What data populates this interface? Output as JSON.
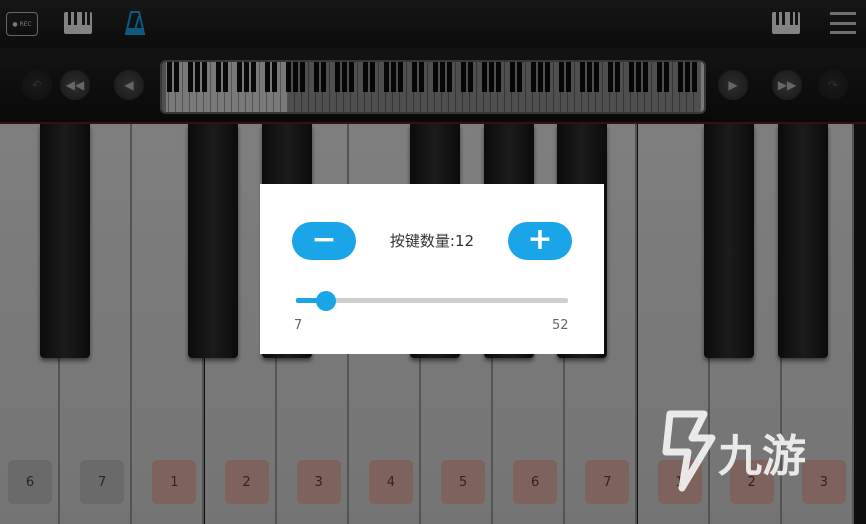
{
  "toolbar": {
    "rec_label": "● REC",
    "icons": [
      "rec-icon",
      "piano-icon",
      "metronome-icon",
      "keyboard-icon",
      "menu-icon"
    ]
  },
  "navigation": {
    "buttons": [
      "undo-icon",
      "rewind-icon",
      "prev-icon",
      "next-icon",
      "fast-forward-icon",
      "redo-icon"
    ]
  },
  "keyboard": {
    "labels": [
      {
        "text": "6",
        "style": "gray"
      },
      {
        "text": "7",
        "style": "gray"
      },
      {
        "text": "1",
        "style": "red"
      },
      {
        "text": "2",
        "style": "red"
      },
      {
        "text": "3",
        "style": "red"
      },
      {
        "text": "4",
        "style": "red"
      },
      {
        "text": "5",
        "style": "red"
      },
      {
        "text": "6",
        "style": "red"
      },
      {
        "text": "7",
        "style": "red"
      },
      {
        "text": "1",
        "style": "red"
      },
      {
        "text": "2",
        "style": "red"
      },
      {
        "text": "3",
        "style": "red"
      }
    ]
  },
  "dialog": {
    "minus_label": "−",
    "plus_label": "+",
    "count_text": "按键数量:12",
    "slider": {
      "min": 7,
      "max": 52,
      "value": 12
    },
    "min_label": "7",
    "max_label": "52"
  },
  "watermark": {
    "text": "九游"
  },
  "colors": {
    "accent": "#19a5e8",
    "label_red": "#e3b2ab",
    "label_gray": "#c2c2c2"
  }
}
